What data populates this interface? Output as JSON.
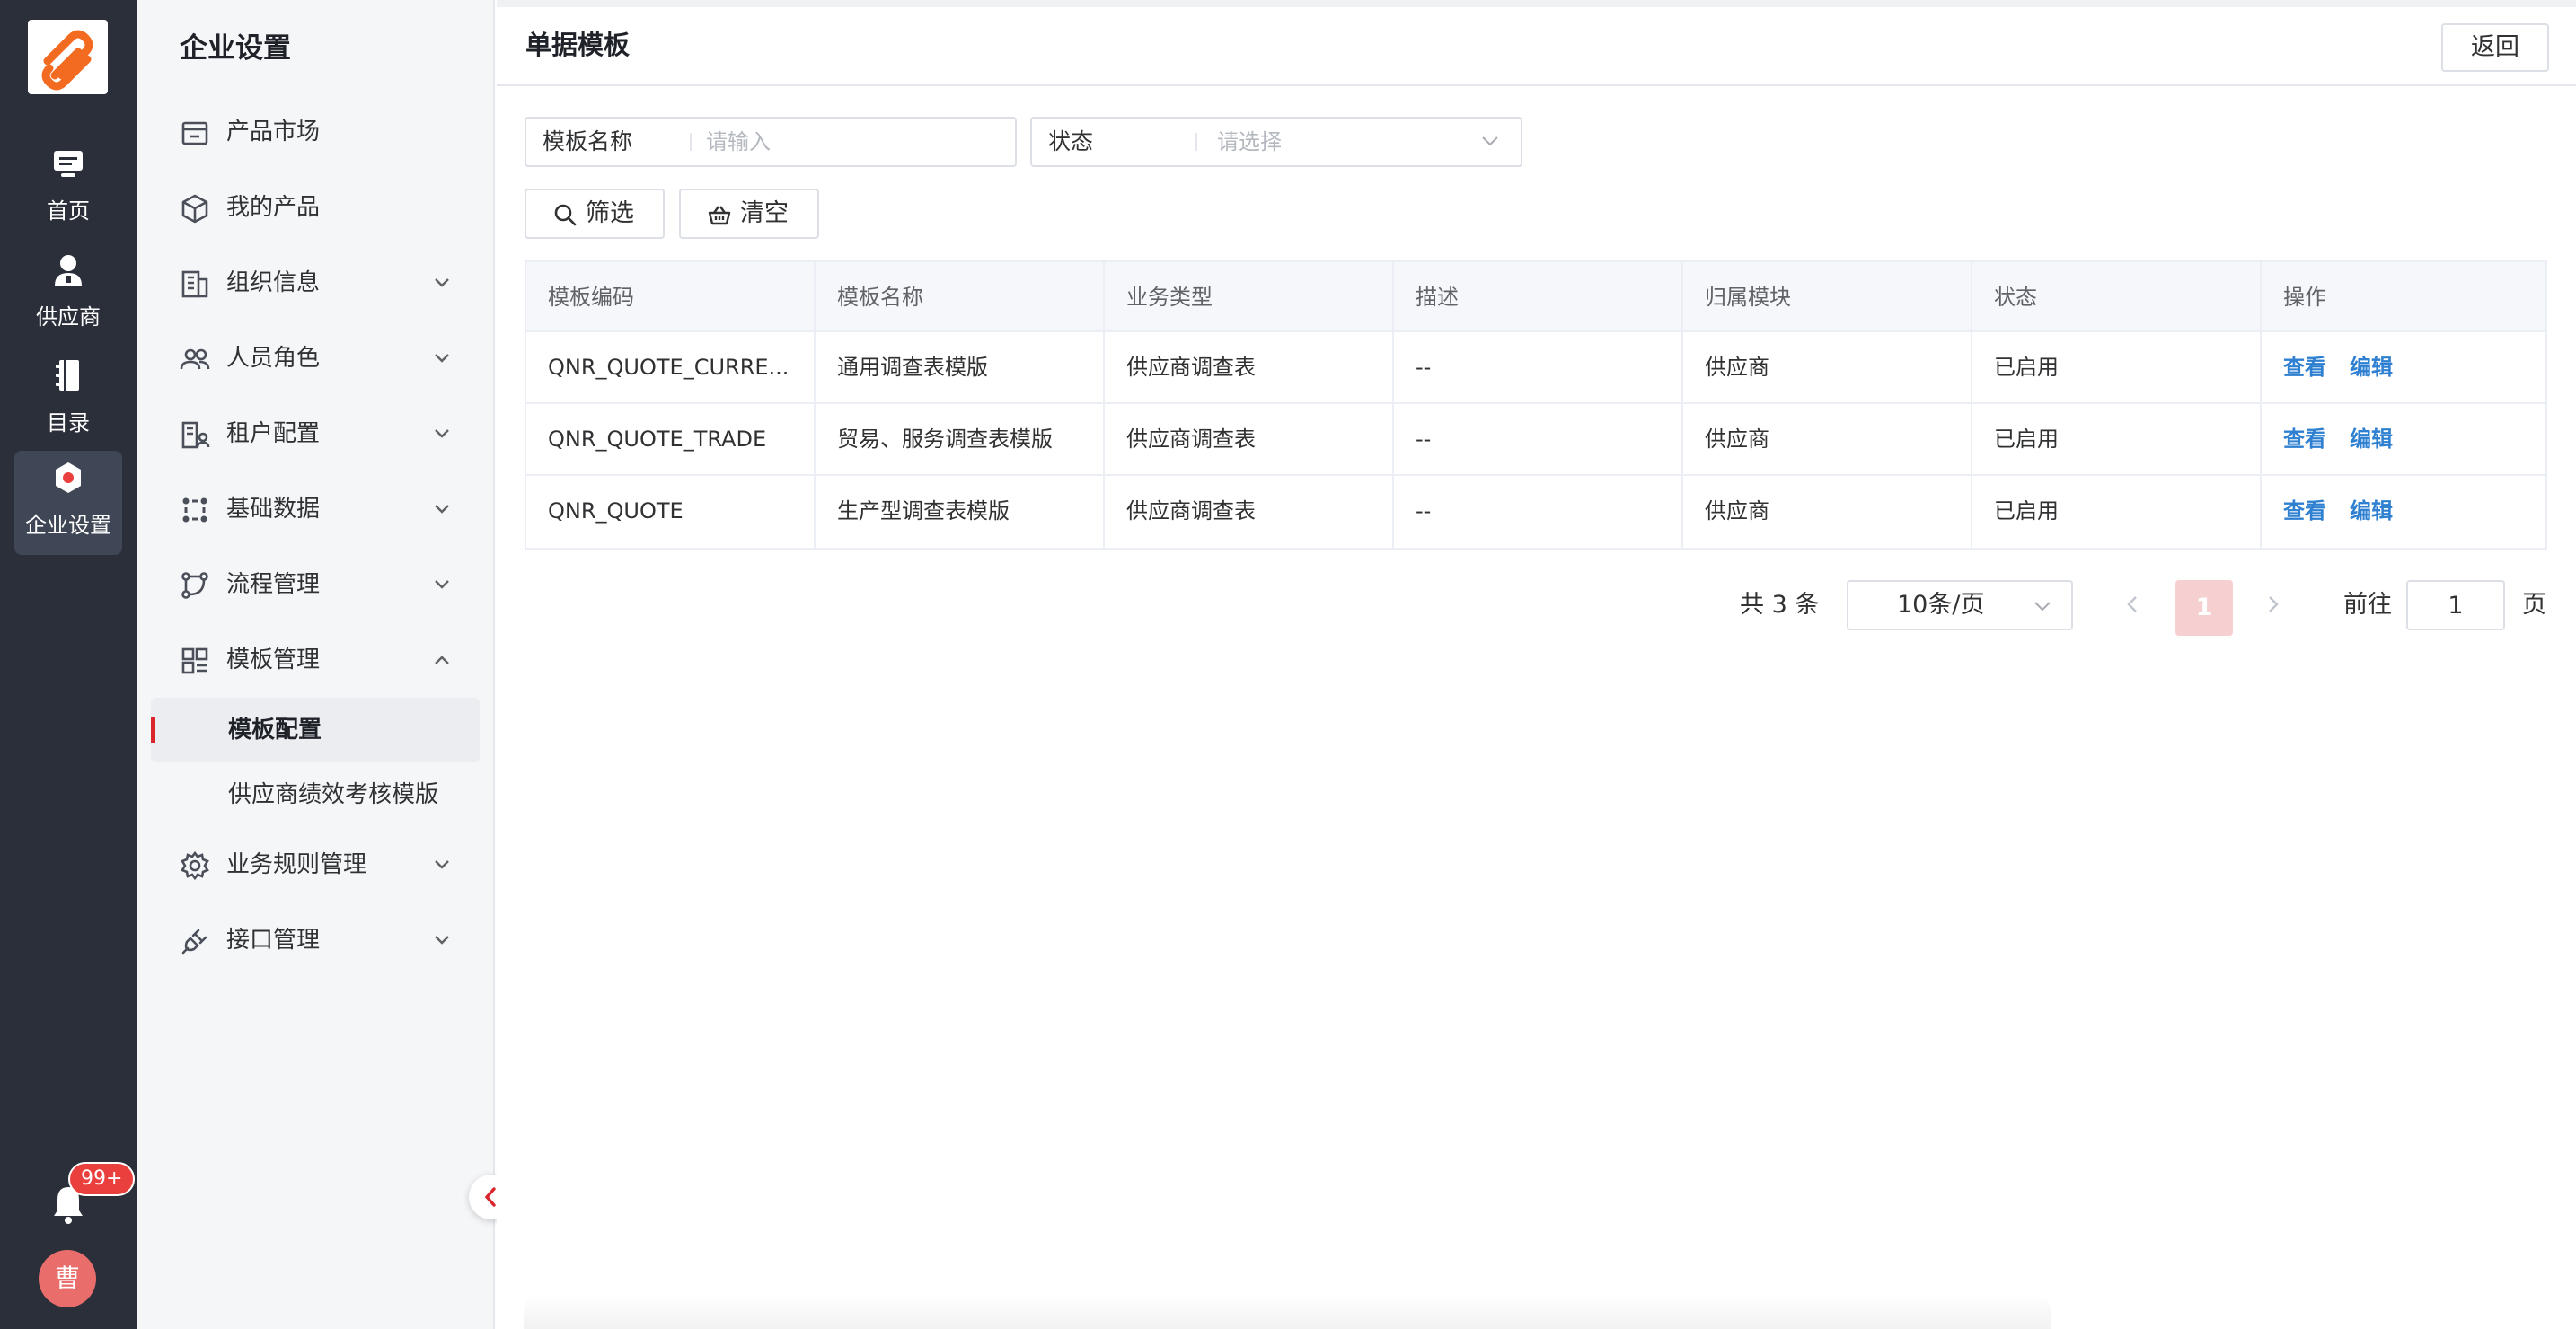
{
  "rail": {
    "items": [
      {
        "label": "首页",
        "icon": "monitor-icon"
      },
      {
        "label": "供应商",
        "icon": "supplier-user-icon"
      },
      {
        "label": "目录",
        "icon": "catalog-book-icon"
      },
      {
        "label": "企业设置",
        "icon": "enterprise-settings-icon",
        "active": true
      }
    ],
    "badge": "99+",
    "avatar": "曹"
  },
  "menu": {
    "title": "企业设置",
    "items": [
      {
        "label": "产品市场",
        "icon": "store-icon"
      },
      {
        "label": "我的产品",
        "icon": "cube-icon"
      },
      {
        "label": "组织信息",
        "icon": "building-icon",
        "expandable": true
      },
      {
        "label": "人员角色",
        "icon": "people-icon",
        "expandable": true
      },
      {
        "label": "租户配置",
        "icon": "tenant-icon",
        "expandable": true
      },
      {
        "label": "基础数据",
        "icon": "data-icon",
        "expandable": true
      },
      {
        "label": "流程管理",
        "icon": "flow-icon",
        "expandable": true
      },
      {
        "label": "模板管理",
        "icon": "template-icon",
        "expanded": true
      }
    ],
    "sub_items": [
      {
        "label": "模板配置",
        "active": true
      },
      {
        "label": "供应商绩效考核模版"
      }
    ],
    "items_after": [
      {
        "label": "业务规则管理",
        "icon": "gear-icon",
        "expandable": true
      },
      {
        "label": "接口管理",
        "icon": "plug-icon",
        "expandable": true
      }
    ]
  },
  "page": {
    "title": "单据模板",
    "back_label": "返回"
  },
  "filters": {
    "name_label": "模板名称",
    "name_placeholder": "请输入",
    "status_label": "状态",
    "status_placeholder": "请选择"
  },
  "buttons": {
    "filter": "筛选",
    "clear": "清空"
  },
  "table": {
    "columns": [
      "模板编码",
      "模板名称",
      "业务类型",
      "描述",
      "归属模块",
      "状态",
      "操作"
    ],
    "rows": [
      {
        "code": "QNR_QUOTE_CURRE...",
        "name": "通用调查表模版",
        "biz_type": "供应商调查表",
        "desc": "--",
        "module": "供应商",
        "status": "已启用",
        "view": "查看",
        "edit": "编辑"
      },
      {
        "code": "QNR_QUOTE_TRADE",
        "name": "贸易、服务调查表模版",
        "biz_type": "供应商调查表",
        "desc": "--",
        "module": "供应商",
        "status": "已启用",
        "view": "查看",
        "edit": "编辑"
      },
      {
        "code": "QNR_QUOTE",
        "name": "生产型调查表模版",
        "biz_type": "供应商调查表",
        "desc": "--",
        "module": "供应商",
        "status": "已启用",
        "view": "查看",
        "edit": "编辑"
      }
    ]
  },
  "pagination": {
    "total": "共 3 条",
    "page_size": "10条/页",
    "current_page": "1",
    "goto_label": "前往",
    "goto_value": "1",
    "goto_suffix": "页"
  },
  "colors": {
    "rail_bg": "#2b2f3a",
    "accent": "#d9262c",
    "link": "#2f80d1",
    "logo_orange": "#f26b21"
  }
}
